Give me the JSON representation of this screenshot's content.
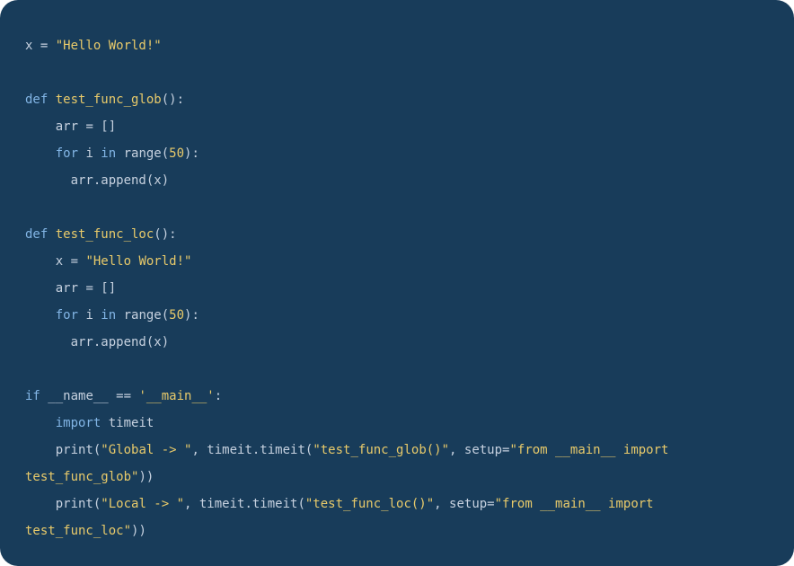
{
  "code": {
    "lines": [
      {
        "indent": 0,
        "tokens": [
          {
            "t": "x ",
            "c": "tk-text"
          },
          {
            "t": "= ",
            "c": "tk-op"
          },
          {
            "t": "\"Hello World!\"",
            "c": "tk-string"
          }
        ]
      },
      {
        "indent": 0,
        "tokens": []
      },
      {
        "indent": 0,
        "tokens": [
          {
            "t": "def ",
            "c": "tk-keyword"
          },
          {
            "t": "test_func_glob",
            "c": "tk-funcname"
          },
          {
            "t": "():",
            "c": "tk-text"
          }
        ]
      },
      {
        "indent": 1,
        "tokens": [
          {
            "t": "arr ",
            "c": "tk-text"
          },
          {
            "t": "= ",
            "c": "tk-op"
          },
          {
            "t": "[]",
            "c": "tk-text"
          }
        ]
      },
      {
        "indent": 1,
        "tokens": [
          {
            "t": "for ",
            "c": "tk-keyword"
          },
          {
            "t": "i ",
            "c": "tk-text"
          },
          {
            "t": "in ",
            "c": "tk-keyword"
          },
          {
            "t": "range(",
            "c": "tk-text"
          },
          {
            "t": "50",
            "c": "tk-number"
          },
          {
            "t": "):",
            "c": "tk-text"
          }
        ]
      },
      {
        "indent": 1,
        "tokens": [
          {
            "t": "  arr.append(x)",
            "c": "tk-text"
          }
        ]
      },
      {
        "indent": 0,
        "tokens": []
      },
      {
        "indent": 0,
        "tokens": [
          {
            "t": "def ",
            "c": "tk-keyword"
          },
          {
            "t": "test_func_loc",
            "c": "tk-funcname"
          },
          {
            "t": "():",
            "c": "tk-text"
          }
        ]
      },
      {
        "indent": 1,
        "tokens": [
          {
            "t": "x ",
            "c": "tk-text"
          },
          {
            "t": "= ",
            "c": "tk-op"
          },
          {
            "t": "\"Hello World!\"",
            "c": "tk-string"
          }
        ]
      },
      {
        "indent": 1,
        "tokens": [
          {
            "t": "arr ",
            "c": "tk-text"
          },
          {
            "t": "= ",
            "c": "tk-op"
          },
          {
            "t": "[]",
            "c": "tk-text"
          }
        ]
      },
      {
        "indent": 1,
        "tokens": [
          {
            "t": "for ",
            "c": "tk-keyword"
          },
          {
            "t": "i ",
            "c": "tk-text"
          },
          {
            "t": "in ",
            "c": "tk-keyword"
          },
          {
            "t": "range(",
            "c": "tk-text"
          },
          {
            "t": "50",
            "c": "tk-number"
          },
          {
            "t": "):",
            "c": "tk-text"
          }
        ]
      },
      {
        "indent": 1,
        "tokens": [
          {
            "t": "  arr.append(x)",
            "c": "tk-text"
          }
        ]
      },
      {
        "indent": 0,
        "tokens": []
      },
      {
        "indent": 0,
        "tokens": [
          {
            "t": "if ",
            "c": "tk-keyword"
          },
          {
            "t": "__name__ ",
            "c": "tk-text"
          },
          {
            "t": "== ",
            "c": "tk-op"
          },
          {
            "t": "'__main__'",
            "c": "tk-string"
          },
          {
            "t": ":",
            "c": "tk-text"
          }
        ]
      },
      {
        "indent": 1,
        "tokens": [
          {
            "t": "import ",
            "c": "tk-keyword"
          },
          {
            "t": "timeit",
            "c": "tk-text"
          }
        ]
      },
      {
        "indent": 1,
        "tokens": [
          {
            "t": "print(",
            "c": "tk-text"
          },
          {
            "t": "\"Global -> \"",
            "c": "tk-string"
          },
          {
            "t": ", timeit.timeit(",
            "c": "tk-text"
          },
          {
            "t": "\"test_func_glob()\"",
            "c": "tk-string"
          },
          {
            "t": ", setup=",
            "c": "tk-text"
          },
          {
            "t": "\"from __main__ import test_func_glob\"",
            "c": "tk-string"
          },
          {
            "t": "))",
            "c": "tk-text"
          }
        ]
      },
      {
        "indent": 1,
        "tokens": [
          {
            "t": "print(",
            "c": "tk-text"
          },
          {
            "t": "\"Local -> \"",
            "c": "tk-string"
          },
          {
            "t": ", timeit.timeit(",
            "c": "tk-text"
          },
          {
            "t": "\"test_func_loc()\"",
            "c": "tk-string"
          },
          {
            "t": ", setup=",
            "c": "tk-text"
          },
          {
            "t": "\"from __main__ import test_func_loc\"",
            "c": "tk-string"
          },
          {
            "t": "))",
            "c": "tk-text"
          }
        ]
      }
    ]
  }
}
